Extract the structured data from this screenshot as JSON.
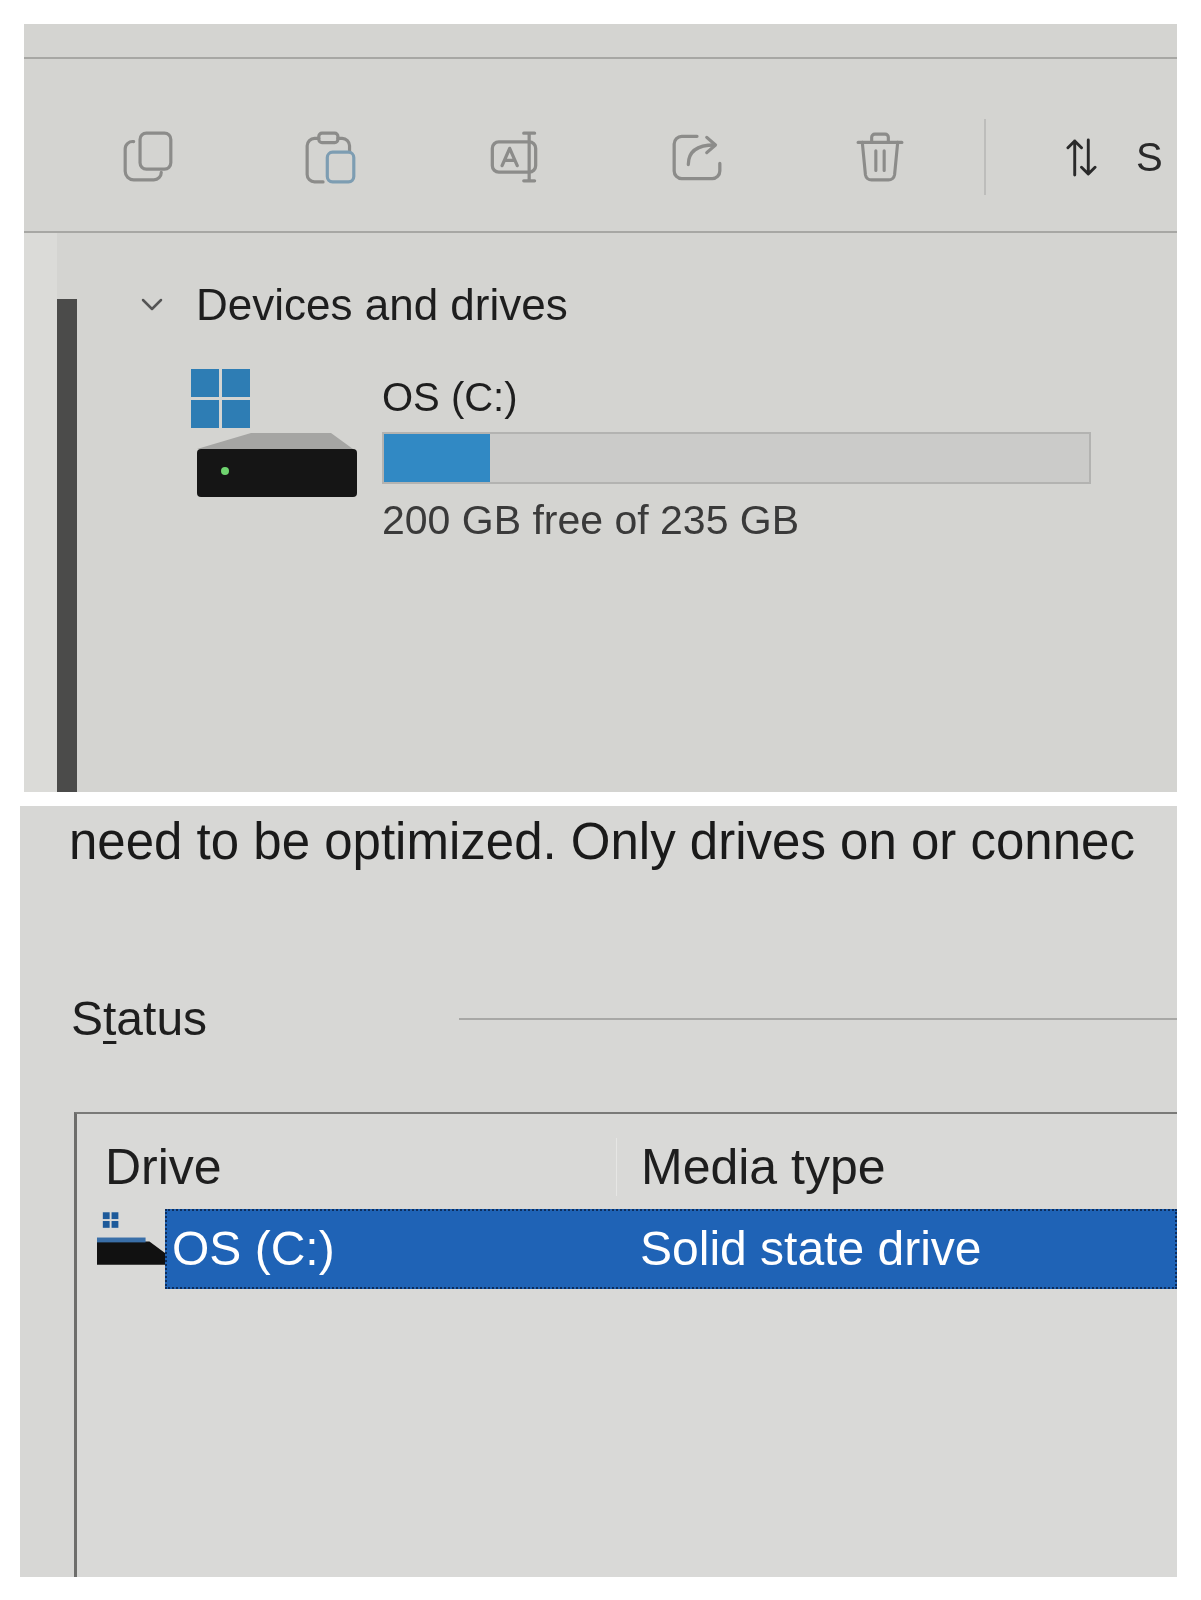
{
  "toolbar": {
    "groups": [
      [
        {
          "kind": "copy",
          "disabled": true
        },
        {
          "kind": "paste",
          "disabled": true
        },
        {
          "kind": "rename",
          "disabled": true
        },
        {
          "kind": "share",
          "disabled": true
        },
        {
          "kind": "delete",
          "disabled": true
        }
      ],
      [
        {
          "kind": "sort",
          "label": "S",
          "disabled": false
        }
      ]
    ]
  },
  "devices_section": {
    "title": "Devices and drives",
    "expanded": true,
    "drives": [
      {
        "name": "OS (C:)",
        "level": 0.15,
        "free_space": "200 GB free of 235 GB"
      }
    ]
  },
  "optimize_drives": {
    "description": "need to be optimized. Only drives on or connec",
    "status_label": [
      {
        "text": "S",
        "underlined": false
      },
      {
        "text": "t",
        "underlined": true
      },
      {
        "text": "atus",
        "underlined": false
      }
    ],
    "drive_list": {
      "columns": [
        "Drive",
        "Media type"
      ],
      "rows": [
        {
          "cells": [
            "OS (C:)",
            "Solid state drive"
          ],
          "selected": true
        }
      ]
    }
  }
}
